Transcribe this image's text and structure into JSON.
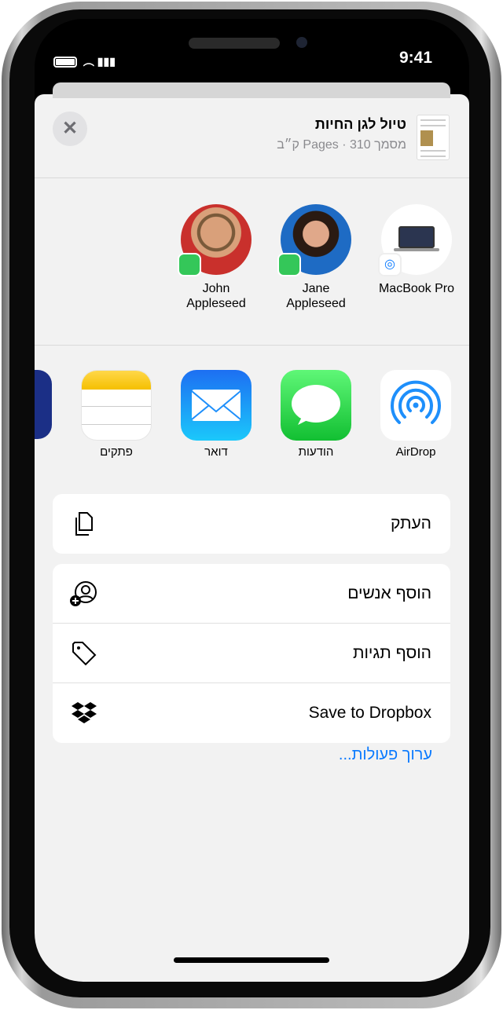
{
  "status_bar": {
    "time": "9:41"
  },
  "share_sheet": {
    "close_icon": "close-icon",
    "document": {
      "title": "טיול לגן החיות",
      "subtitle": "מסמך Pages · 310 ק״ב"
    },
    "people": [
      {
        "first": "John",
        "last": "Appleseed",
        "badge": "messages"
      },
      {
        "first": "Jane",
        "last": "Appleseed",
        "badge": "messages"
      }
    ],
    "device": {
      "name": "MacBook Pro",
      "badge": "airdrop"
    },
    "apps": [
      {
        "label": "AirDrop",
        "icon": "airdrop-icon"
      },
      {
        "label": "הודעות",
        "icon": "messages-icon"
      },
      {
        "label": "דואר",
        "icon": "mail-icon"
      },
      {
        "label": "פתקים",
        "icon": "notes-icon"
      }
    ],
    "actions_group1": [
      {
        "label": "העתק",
        "icon": "copy-icon"
      }
    ],
    "actions_group2": [
      {
        "label": "הוסף אנשים",
        "icon": "add-people-icon"
      },
      {
        "label": "הוסף תגיות",
        "icon": "tag-icon"
      },
      {
        "label": "Save to Dropbox",
        "icon": "dropbox-icon"
      }
    ],
    "edit_actions": "ערוך פעולות..."
  },
  "colors": {
    "accent": "#0a7aff",
    "messages_green": "#34c759",
    "mail_blue": "#1e8ffb",
    "notes_yellow": "#ffd60a"
  }
}
